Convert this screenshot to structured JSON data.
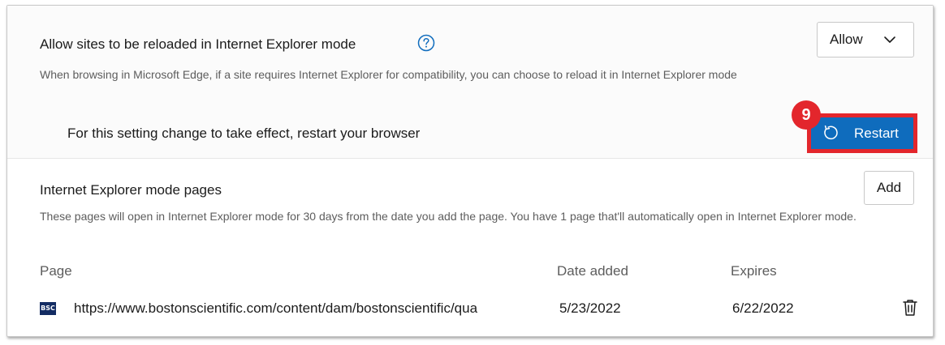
{
  "ie_reload": {
    "title": "Allow sites to be reloaded in Internet Explorer mode",
    "description": "When browsing in Microsoft Edge, if a site requires Internet Explorer for compatibility, you can choose to reload it in Internet Explorer mode",
    "selected_option": "Allow",
    "restart_message": "For this setting change to take effect, restart your browser",
    "restart_label": "Restart",
    "step_number": "9"
  },
  "ie_pages": {
    "title": "Internet Explorer mode pages",
    "add_label": "Add",
    "description": "These pages will open in Internet Explorer mode for 30 days from the date you add the page. You have 1 page that'll automatically open in Internet Explorer mode.",
    "columns": {
      "page": "Page",
      "date_added": "Date added",
      "expires": "Expires"
    },
    "rows": [
      {
        "favicon_text": "BSC",
        "url": "https://www.bostonscientific.com/content/dam/bostonscientific/qua",
        "date_added": "5/23/2022",
        "expires": "6/22/2022"
      }
    ]
  },
  "icons": {
    "help": "help-circle-icon",
    "chevron": "chevron-down-icon",
    "restart": "refresh-icon",
    "delete": "trash-icon"
  },
  "colors": {
    "accent": "#0f6cbd",
    "highlight": "#e3262c",
    "favicon_bg": "#132c63"
  }
}
